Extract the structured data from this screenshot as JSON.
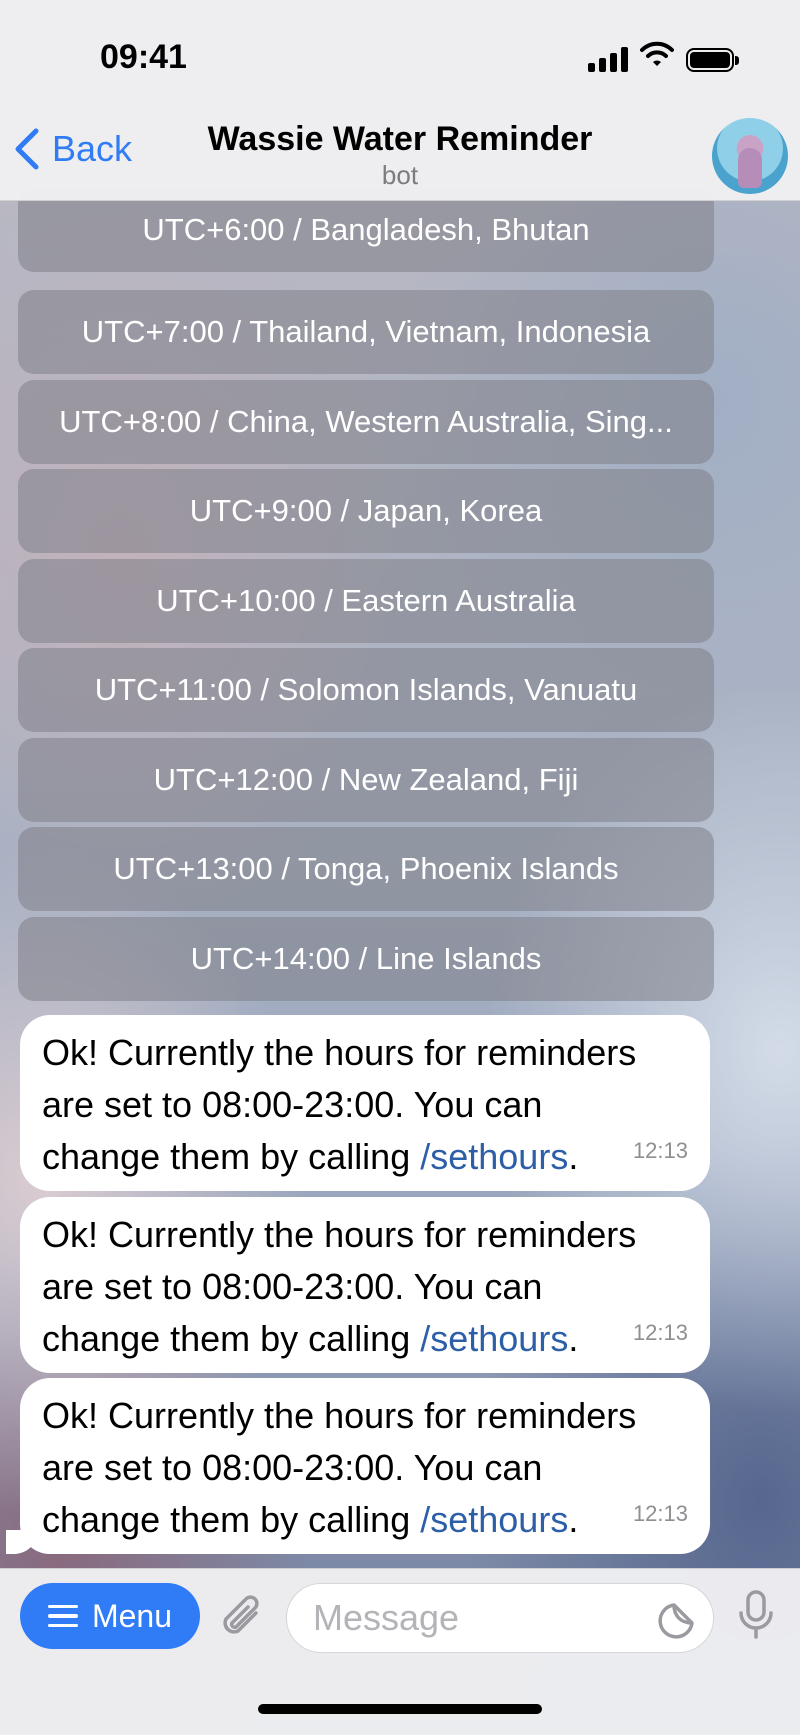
{
  "status_bar": {
    "time": "09:41"
  },
  "header": {
    "back_label": "Back",
    "title": "Wassie Water Reminder",
    "subtitle": "bot"
  },
  "keyboard_buttons": [
    "UTC+6:00 / Bangladesh, Bhutan",
    "UTC+7:00 / Thailand, Vietnam, Indonesia",
    "UTC+8:00 / China, Western Australia, Sing...",
    "UTC+9:00 / Japan, Korea",
    "UTC+10:00 / Eastern Australia",
    "UTC+11:00 / Solomon Islands, Vanuatu",
    "UTC+12:00 / New Zealand, Fiji",
    "UTC+13:00 / Tonga, Phoenix Islands",
    "UTC+14:00 / Line Islands"
  ],
  "messages": [
    {
      "line1": "Ok! Currently the hours for reminders",
      "line2": "are set to 08:00-23:00. You can",
      "line3": "change them by calling ",
      "command": "/sethours",
      "suffix": ".",
      "time": "12:13"
    },
    {
      "line1": "Ok! Currently the hours for reminders",
      "line2": "are set to 08:00-23:00. You can",
      "line3": "change them by calling ",
      "command": "/sethours",
      "suffix": ".",
      "time": "12:13"
    },
    {
      "line1": "Ok! Currently the hours for reminders",
      "line2": "are set to 08:00-23:00. You can",
      "line3": "change them by calling ",
      "command": "/sethours",
      "suffix": ".",
      "time": "12:13"
    }
  ],
  "input_bar": {
    "menu_label": "Menu",
    "message_placeholder": "Message",
    "message_value": ""
  },
  "icons": {
    "back": "chevron-left-icon",
    "menu": "hamburger-icon",
    "attach": "paperclip-icon",
    "sticker": "sticker-icon",
    "mic": "microphone-icon",
    "signal": "cellular-signal-icon",
    "wifi": "wifi-icon",
    "battery": "battery-icon"
  },
  "colors": {
    "accent": "#2f7cf6",
    "command_link": "#2d5fa8",
    "bubble": "#ffffff",
    "keyboard_button": "#808088"
  }
}
